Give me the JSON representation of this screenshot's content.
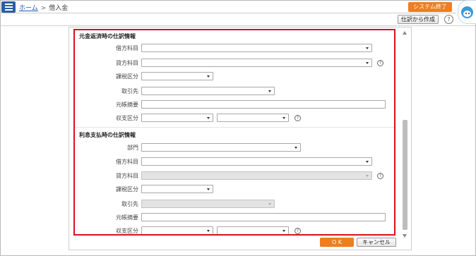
{
  "header": {
    "breadcrumb_home": "ホーム",
    "breadcrumb_sep": ">",
    "breadcrumb_current": "借入金",
    "system_exit_label": "システム終了"
  },
  "toolbar": {
    "create_from_entry_label": "仕訳から作成",
    "help_label": "?"
  },
  "section1": {
    "title": "元金返済時の仕訳情報",
    "debit_account_label": "借方科目",
    "credit_account_label": "貸方科目",
    "tax_category_label": "課税区分",
    "partner_label": "取引先",
    "ledger_memo_label": "元帳摘要",
    "income_expense_label": "収支区分"
  },
  "section2": {
    "title": "利息支払時の仕訳情報",
    "department_label": "部門",
    "debit_account_label": "借方科目",
    "credit_account_label": "貸方科目",
    "tax_category_label": "課税区分",
    "partner_label": "取引先",
    "ledger_memo_label": "元帳摘要",
    "income_expense_label": "収支区分"
  },
  "field_help_label": "?",
  "footer": {
    "ok_label": "O K",
    "cancel_label": "キャンセル"
  },
  "colors": {
    "accent_orange": "#ee7e1f",
    "highlight_red": "#d8111b",
    "menu_blue": "#2b5ea8"
  },
  "icons": [
    "hamburger-menu-icon",
    "help-icon",
    "assistant-avatar-icon",
    "dropdown-arrow-icon"
  ]
}
